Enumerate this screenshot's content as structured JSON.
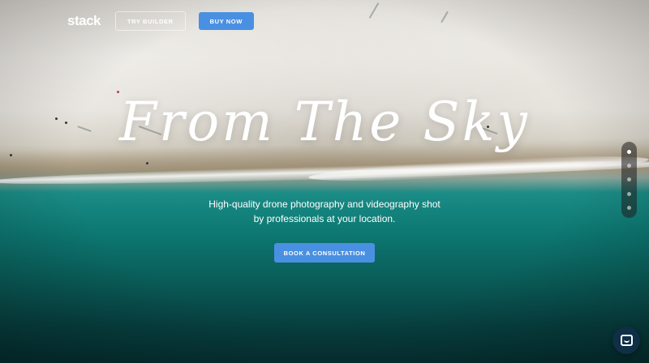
{
  "nav": {
    "logo": "stack",
    "try_builder_label": "TRY BUILDER",
    "buy_now_label": "BUY NOW"
  },
  "hero": {
    "headline": "From The Sky",
    "subtitle": "High-quality drone photography and videography shot by professionals at your location.",
    "cta_label": "BOOK A CONSULTATION"
  },
  "section_nav": {
    "count": 5,
    "active_index": 0
  },
  "colors": {
    "accent": "#4a90e2",
    "text": "#ffffff",
    "chat_bg": "#0e2f45"
  },
  "icons": {
    "chat": "chat-icon"
  }
}
